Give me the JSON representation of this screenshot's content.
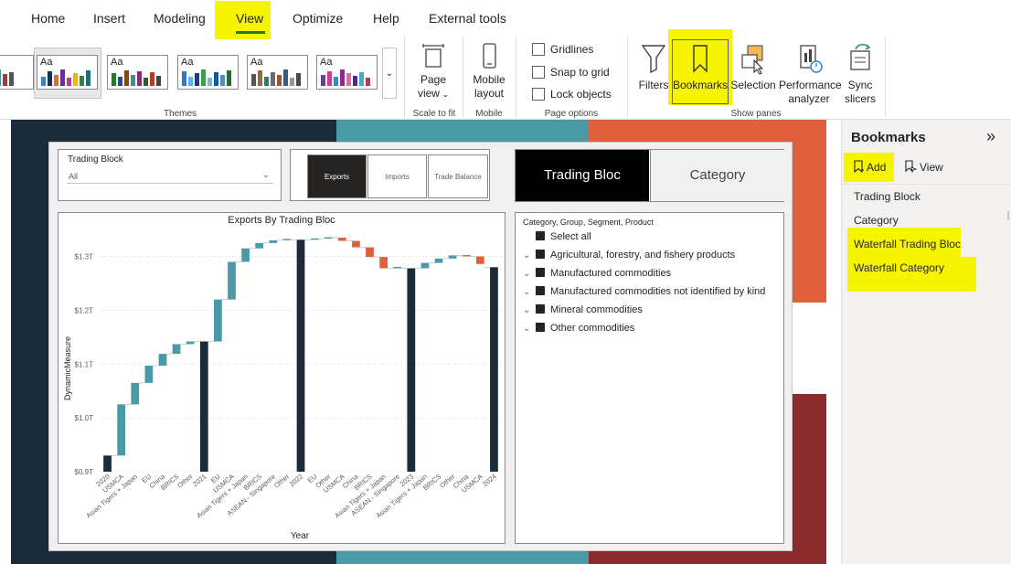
{
  "ribbon": {
    "tabs": [
      "Home",
      "Insert",
      "Modeling",
      "View",
      "Optimize",
      "Help",
      "External tools"
    ],
    "active_tab": "View",
    "groups": {
      "themes": "Themes",
      "scale_to_fit": "Scale to fit",
      "mobile": "Mobile",
      "page_options": "Page options",
      "show_panes": "Show panes"
    },
    "theme_sample_text": "Aa",
    "page_view": {
      "line1": "Page",
      "line2": "view"
    },
    "mobile_layout": {
      "line1": "Mobile",
      "line2": "layout"
    },
    "page_options": {
      "gridlines": "Gridlines",
      "snap_to_grid": "Snap to grid",
      "lock_objects": "Lock objects"
    },
    "panes": {
      "filters": "Filters",
      "bookmarks": "Bookmarks",
      "selection": "Selection",
      "performance": {
        "line1": "Performance",
        "line2": "analyzer"
      },
      "sync": {
        "line1": "Sync",
        "line2": "slicers"
      }
    },
    "icons": [
      "filter-icon",
      "bookmark-icon",
      "selection-icon",
      "performance-analyzer-icon",
      "sync-slicers-icon",
      "page-view-icon",
      "mobile-layout-icon"
    ]
  },
  "report": {
    "slicer": {
      "title": "Trading Block",
      "value": "All"
    },
    "segments": [
      "Exports",
      "Imports",
      "Trade Balance"
    ],
    "active_segment": "Exports",
    "big_tabs": [
      "Trading Bloc",
      "Category"
    ],
    "active_big_tab": "Trading Bloc",
    "legend": {
      "title": "Category, Group, Segment, Product",
      "items": [
        "Select all",
        "Agricultural, forestry, and fishery products",
        "Manufactured commodities",
        "Manufactured commodities not identified by kind",
        "Mineral commodities",
        "Other commodities"
      ]
    }
  },
  "chart_data": {
    "type": "waterfall",
    "title": "Exports By Trading Bloc",
    "xlabel": "Year",
    "ylabel": "DynamicMeasure",
    "ylim": [
      0.9,
      1.34
    ],
    "ytick_values": [
      0.9,
      1.0,
      1.1,
      1.2,
      1.3
    ],
    "ytick_labels": [
      "$0.9T",
      "$1.0T",
      "$1.1T",
      "$1.2T",
      "$1.3T"
    ],
    "colors": {
      "increase": "#4a9aa5",
      "decrease": "#e0603e",
      "total": "#1c2b3a"
    },
    "categories": [
      "2020",
      "USMCA",
      "Asian Tigers + Japan",
      "EU",
      "China",
      "BRICS",
      "Other",
      "2021",
      "EU",
      "USMCA",
      "Asian Tigers + Japan",
      "BRICS",
      "ASEAN - Singapore",
      "Other",
      "2022",
      "EU",
      "Other",
      "USMCA",
      "China",
      "BRICS",
      "Asian Tigers + Japan",
      "ASEAN - Singapore",
      "2023",
      "Asian Tigers + Japan",
      "BRICS",
      "Other",
      "China",
      "USMCA",
      "2024"
    ],
    "bars": [
      {
        "kind": "total",
        "value": 0.93
      },
      {
        "kind": "delta",
        "value": 0.095
      },
      {
        "kind": "delta",
        "value": 0.04
      },
      {
        "kind": "delta",
        "value": 0.032
      },
      {
        "kind": "delta",
        "value": 0.022
      },
      {
        "kind": "delta",
        "value": 0.018
      },
      {
        "kind": "delta",
        "value": 0.005
      },
      {
        "kind": "total",
        "value": 1.142
      },
      {
        "kind": "delta",
        "value": 0.078
      },
      {
        "kind": "delta",
        "value": 0.07
      },
      {
        "kind": "delta",
        "value": 0.025
      },
      {
        "kind": "delta",
        "value": 0.01
      },
      {
        "kind": "delta",
        "value": 0.005
      },
      {
        "kind": "delta",
        "value": 0.001
      },
      {
        "kind": "total",
        "value": 1.331
      },
      {
        "kind": "delta",
        "value": 0.002
      },
      {
        "kind": "delta",
        "value": 0.002
      },
      {
        "kind": "delta",
        "value": -0.006
      },
      {
        "kind": "delta",
        "value": -0.012
      },
      {
        "kind": "delta",
        "value": -0.018
      },
      {
        "kind": "delta",
        "value": -0.021
      },
      {
        "kind": "delta",
        "value": 0.0
      },
      {
        "kind": "total",
        "value": 1.278
      },
      {
        "kind": "delta",
        "value": 0.01
      },
      {
        "kind": "delta",
        "value": 0.008
      },
      {
        "kind": "delta",
        "value": 0.006
      },
      {
        "kind": "delta",
        "value": -0.002
      },
      {
        "kind": "delta",
        "value": -0.014
      },
      {
        "kind": "total",
        "value": 1.28
      }
    ]
  },
  "pane": {
    "title": "Bookmarks",
    "add_label": "Add",
    "view_label": "View",
    "items": [
      "Trading Block",
      "Category",
      "Waterfall Trading Bloc",
      "Waterfall Category"
    ]
  },
  "highlight_color": "#f7f400"
}
